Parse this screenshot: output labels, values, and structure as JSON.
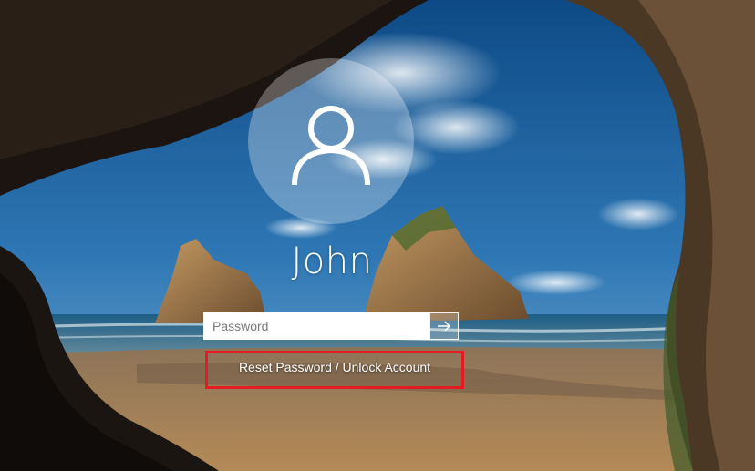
{
  "screen": "Windows sign-in screen",
  "user": {
    "avatar_icon": "user-silhouette-icon",
    "name": "John"
  },
  "password_field": {
    "placeholder": "Password",
    "value": ""
  },
  "submit_button": {
    "icon": "arrow-right-icon"
  },
  "reset_link": {
    "label": "Reset Password / Unlock Account"
  },
  "colors": {
    "highlight_border": "#e31b23",
    "text": "#ffffff",
    "sky": "#2f6fa8",
    "sand": "#b68a55",
    "cave": "#1b1410"
  }
}
